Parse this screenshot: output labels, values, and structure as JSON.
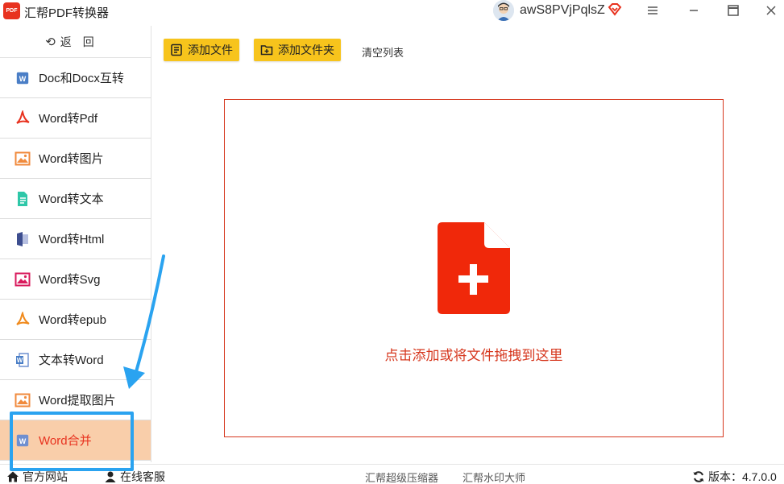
{
  "app": {
    "logo_text": "PDF",
    "title": "汇帮PDF转换器",
    "username": "awS8PVjPqlsZ"
  },
  "window": {
    "menu_icon": "hamburger-menu-icon",
    "minimize_icon": "minimize-icon",
    "maximize_icon": "maximize-icon",
    "close_icon": "close-icon"
  },
  "sidebar": {
    "back_label": "返回",
    "items": [
      {
        "label": "Doc和Docx互转",
        "icon": "word-icon"
      },
      {
        "label": "Word转Pdf",
        "icon": "pdf-icon"
      },
      {
        "label": "Word转图片",
        "icon": "image-icon"
      },
      {
        "label": "Word转文本",
        "icon": "text-file-icon"
      },
      {
        "label": "Word转Html",
        "icon": "html-icon"
      },
      {
        "label": "Word转Svg",
        "icon": "svg-image-icon"
      },
      {
        "label": "Word转epub",
        "icon": "epub-icon"
      },
      {
        "label": "文本转Word",
        "icon": "word-doc-icon"
      },
      {
        "label": "Word提取图片",
        "icon": "image-icon"
      },
      {
        "label": "Word合并",
        "icon": "word-icon",
        "active": true
      }
    ]
  },
  "toolbar": {
    "add_file_label": "添加文件",
    "add_folder_label": "添加文件夹",
    "clear_list_label": "清空列表"
  },
  "dropzone": {
    "text": "点击添加或将文件拖拽到这里"
  },
  "statusbar": {
    "official_site": "官方网站",
    "online_service": "在线客服",
    "compressor": "汇帮超级压缩器",
    "watermark": "汇帮水印大师",
    "version_label": "版本：",
    "version": "4.7.0.0"
  },
  "colors": {
    "accent_red": "#e8321f",
    "toolbar_yellow": "#f7c41c",
    "active_bg": "#f9ceaa",
    "annotation_blue": "#2aa3f0"
  }
}
